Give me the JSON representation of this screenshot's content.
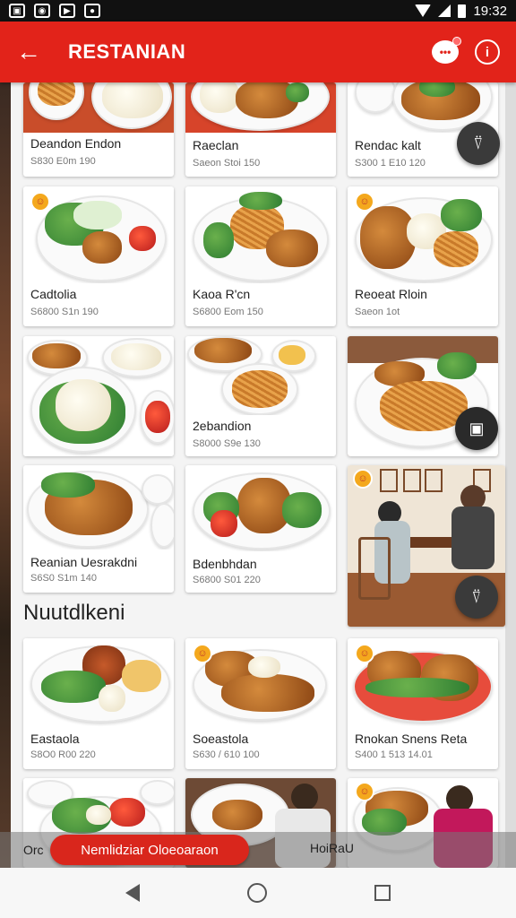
{
  "status": {
    "time": "19:32"
  },
  "app": {
    "title": "RESTANIAN",
    "accent": "#e2231a"
  },
  "icons": {
    "back": "back-arrow-icon",
    "chat": "chat-bubble-icon",
    "info": "info-icon",
    "fab": "table-dining-icon"
  },
  "grid1": [
    {
      "name": "Deandon Endon",
      "meta": "S830 E0m    190"
    },
    {
      "name": "Raeclan",
      "meta": "Saeon Stoi    150"
    },
    {
      "name": "Rendac kalt",
      "meta": "S300 1 E10    120"
    },
    {
      "name": "Cadtolia",
      "meta": "S6800 S1n    190"
    },
    {
      "name": "Kaoa R'cn",
      "meta": "S6800 Eom    150"
    },
    {
      "name": "Reoeat Rloin",
      "meta": "Saeon 1ot"
    },
    {
      "name": "2ebandion",
      "meta": "S8000 S9e    130"
    },
    {
      "name": "Reanian Uesrakdni",
      "meta": "S6S0 S1m    140"
    },
    {
      "name": "Bdenbhdan",
      "meta": "S6800 S01    220"
    }
  ],
  "section_title": "Nuutdlkeni",
  "grid2": [
    {
      "name": "Eastaola",
      "meta": "S8O0 R00    220"
    },
    {
      "name": "Soeastola",
      "meta": "S630 / 610    100"
    },
    {
      "name": "Rnokan Snens Reta",
      "meta": "S400 1 513    14.01"
    }
  ],
  "bottom_bar": {
    "left": "Orc",
    "main": "Nemlidziar Oloeoaraon",
    "right": "HoiRaU"
  }
}
